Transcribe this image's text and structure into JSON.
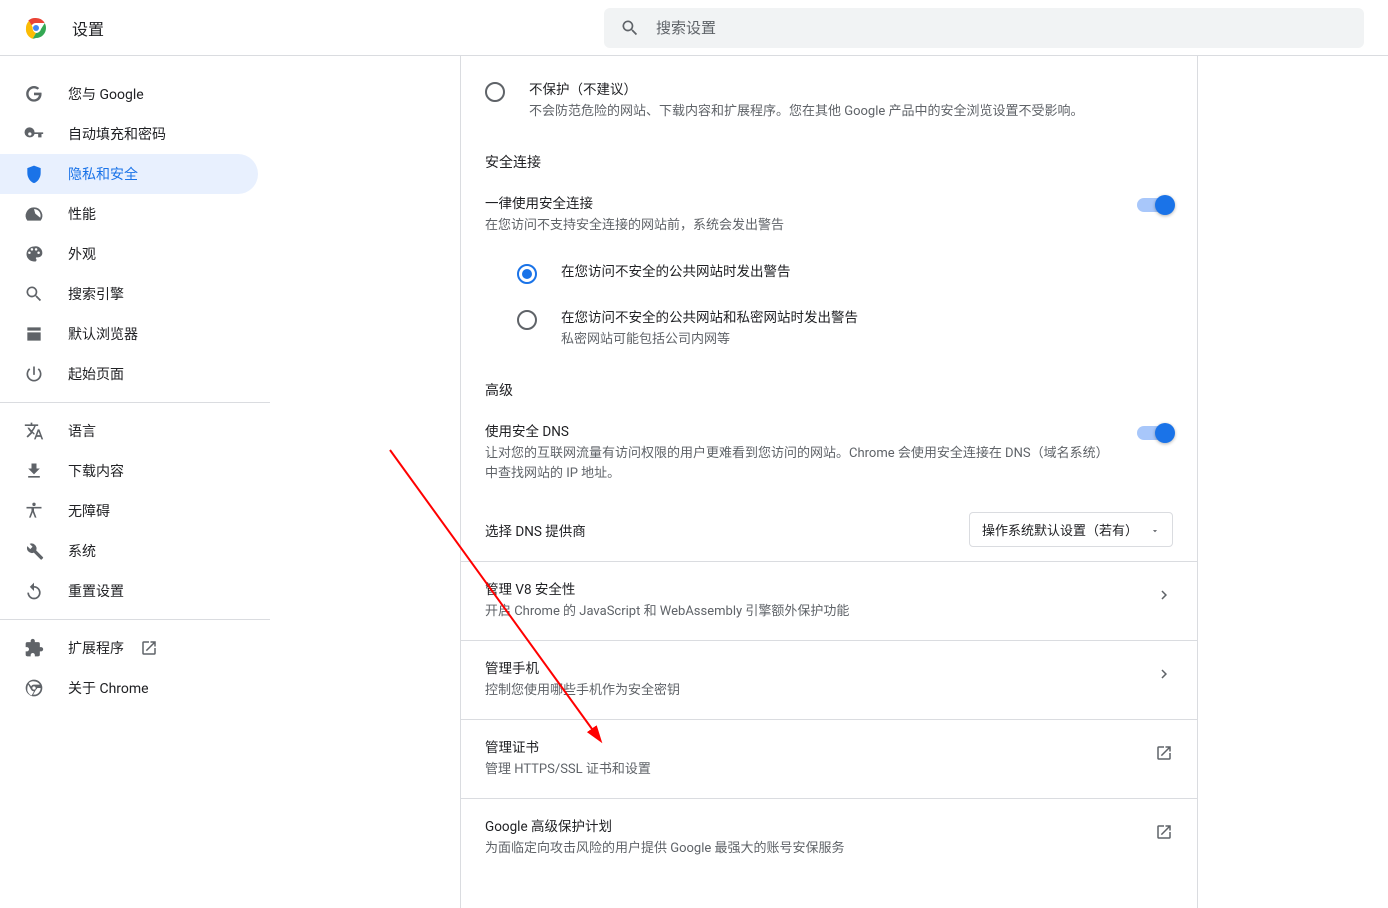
{
  "header": {
    "title": "设置",
    "search_placeholder": "搜索设置"
  },
  "sidebar": {
    "items": [
      {
        "label": "您与 Google"
      },
      {
        "label": "自动填充和密码"
      },
      {
        "label": "隐私和安全"
      },
      {
        "label": "性能"
      },
      {
        "label": "外观"
      },
      {
        "label": "搜索引擎"
      },
      {
        "label": "默认浏览器"
      },
      {
        "label": "起始页面"
      },
      {
        "label": "语言"
      },
      {
        "label": "下载内容"
      },
      {
        "label": "无障碍"
      },
      {
        "label": "系统"
      },
      {
        "label": "重置设置"
      },
      {
        "label": "扩展程序"
      },
      {
        "label": "关于 Chrome"
      }
    ]
  },
  "main": {
    "no_protect": {
      "title": "不保护（不建议）",
      "sub": "不会防范危险的网站、下载内容和扩展程序。您在其他 Google 产品中的安全浏览设置不受影响。"
    },
    "secure_conn_heading": "安全连接",
    "always_https": {
      "title": "一律使用安全连接",
      "sub": "在您访问不支持安全连接的网站前，系统会发出警告"
    },
    "https_opt1": {
      "title": "在您访问不安全的公共网站时发出警告"
    },
    "https_opt2": {
      "title": "在您访问不安全的公共网站和私密网站时发出警告",
      "sub": "私密网站可能包括公司内网等"
    },
    "advanced_heading": "高级",
    "secure_dns": {
      "title": "使用安全 DNS",
      "sub": "让对您的互联网流量有访问权限的用户更难看到您访问的网站。Chrome 会使用安全连接在 DNS（域名系统）中查找网站的 IP 地址。"
    },
    "dns_provider": {
      "label": "选择 DNS 提供商",
      "value": "操作系统默认设置（若有）"
    },
    "v8": {
      "title": "管理 V8 安全性",
      "sub": "开启 Chrome 的 JavaScript 和 WebAssembly 引擎额外保护功能"
    },
    "phone": {
      "title": "管理手机",
      "sub": "控制您使用哪些手机作为安全密钥"
    },
    "cert": {
      "title": "管理证书",
      "sub": "管理 HTTPS/SSL 证书和设置"
    },
    "app": {
      "title": "Google 高级保护计划",
      "sub": "为面临定向攻击风险的用户提供 Google 最强大的账号安保服务"
    }
  }
}
